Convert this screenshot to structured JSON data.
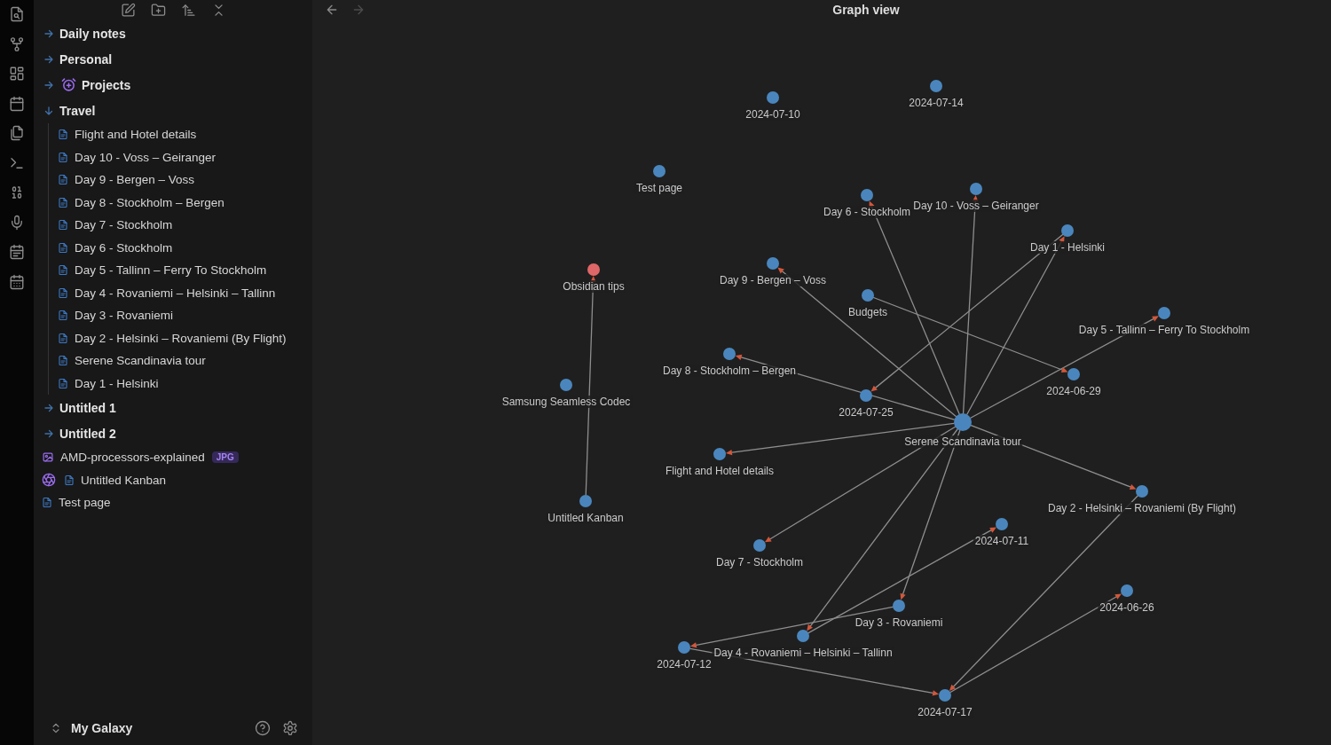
{
  "sidebar": {
    "tree": [
      {
        "kind": "folder",
        "label": "Daily notes",
        "expanded": false
      },
      {
        "kind": "folder",
        "label": "Personal",
        "expanded": false
      },
      {
        "kind": "iconfolder",
        "label": "Projects",
        "expanded": false
      },
      {
        "kind": "folder",
        "label": "Travel",
        "expanded": true,
        "children": [
          {
            "kind": "file",
            "label": "Flight and Hotel details"
          },
          {
            "kind": "file",
            "label": "Day 10 - Voss – Geiranger"
          },
          {
            "kind": "file",
            "label": "Day 9 - Bergen – Voss"
          },
          {
            "kind": "file",
            "label": "Day 8 - Stockholm – Bergen"
          },
          {
            "kind": "file",
            "label": "Day 7 - Stockholm"
          },
          {
            "kind": "file",
            "label": "Day 6 - Stockholm"
          },
          {
            "kind": "file",
            "label": "Day 5 - Tallinn – Ferry To Stockholm"
          },
          {
            "kind": "file",
            "label": "Day 4 - Rovaniemi – Helsinki – Tallinn"
          },
          {
            "kind": "file",
            "label": "Day 3 - Rovaniemi"
          },
          {
            "kind": "file",
            "label": "Day 2 - Helsinki – Rovaniemi (By Flight)"
          },
          {
            "kind": "file",
            "label": "Serene Scandinavia tour"
          },
          {
            "kind": "file",
            "label": "Day 1 - Helsinki"
          }
        ]
      },
      {
        "kind": "folder",
        "label": "Untitled 1",
        "expanded": false
      },
      {
        "kind": "folder",
        "label": "Untitled 2",
        "expanded": false
      },
      {
        "kind": "image",
        "label": "AMD-processors-explained",
        "badge": "JPG"
      },
      {
        "kind": "kanban",
        "label": "Untitled Kanban"
      },
      {
        "kind": "file",
        "label": "Test page"
      }
    ],
    "vault": "My Galaxy"
  },
  "main": {
    "nav": {
      "back_disabled": false,
      "forward_disabled": true
    },
    "title": "Graph view"
  },
  "graph": {
    "nodes": [
      {
        "kind": "note",
        "label": "2024-07-10",
        "color": "#4a86bd"
      },
      {
        "kind": "note",
        "label": "2024-07-14",
        "color": "#4a86bd"
      },
      {
        "kind": "note",
        "label": "Test page",
        "color": "#4a86bd"
      },
      {
        "kind": "note",
        "label": "Day 6 - Stockholm",
        "color": "#4a86bd"
      },
      {
        "kind": "note",
        "label": "Day 10 - Voss – Geiranger",
        "color": "#4a86bd"
      },
      {
        "kind": "note",
        "label": "Day 1 - Helsinki",
        "color": "#4a86bd"
      },
      {
        "kind": "note",
        "label": "Obsidian tips",
        "color": "#e06767"
      },
      {
        "kind": "note",
        "label": "Day 9 - Bergen – Voss",
        "color": "#4a86bd"
      },
      {
        "kind": "note",
        "label": "Budgets",
        "color": "#4a86bd"
      },
      {
        "kind": "note",
        "label": "Day 5 - Tallinn – Ferry To Stockholm",
        "color": "#4a86bd"
      },
      {
        "kind": "note",
        "label": "Day 8 - Stockholm – Bergen",
        "color": "#4a86bd"
      },
      {
        "kind": "note",
        "label": "2024-06-29",
        "color": "#4a86bd"
      },
      {
        "kind": "note",
        "label": "Samsung Seamless Codec",
        "color": "#4a86bd"
      },
      {
        "kind": "note",
        "label": "2024-07-25",
        "color": "#4a86bd"
      },
      {
        "kind": "hub",
        "label": "Serene Scandinavia tour",
        "color": "#4a86bd"
      },
      {
        "kind": "note",
        "label": "Flight and Hotel details",
        "color": "#4a86bd"
      },
      {
        "kind": "note",
        "label": "Day 2 - Helsinki – Rovaniemi (By Flight)",
        "color": "#4a86bd"
      },
      {
        "kind": "note",
        "label": "Untitled Kanban",
        "color": "#4a86bd"
      },
      {
        "kind": "note",
        "label": "2024-07-11",
        "color": "#4a86bd"
      },
      {
        "kind": "note",
        "label": "Day 7 - Stockholm",
        "color": "#4a86bd"
      },
      {
        "kind": "note",
        "label": "2024-06-26",
        "color": "#4a86bd"
      },
      {
        "kind": "note",
        "label": "Day 3 - Rovaniemi",
        "color": "#4a86bd"
      },
      {
        "kind": "note",
        "label": "Day 4 - Rovaniemi – Helsinki – Tallinn",
        "color": "#4a86bd"
      },
      {
        "kind": "note",
        "label": "2024-07-12",
        "color": "#4a86bd"
      },
      {
        "kind": "note",
        "label": "2024-07-17",
        "color": "#4a86bd"
      }
    ]
  }
}
